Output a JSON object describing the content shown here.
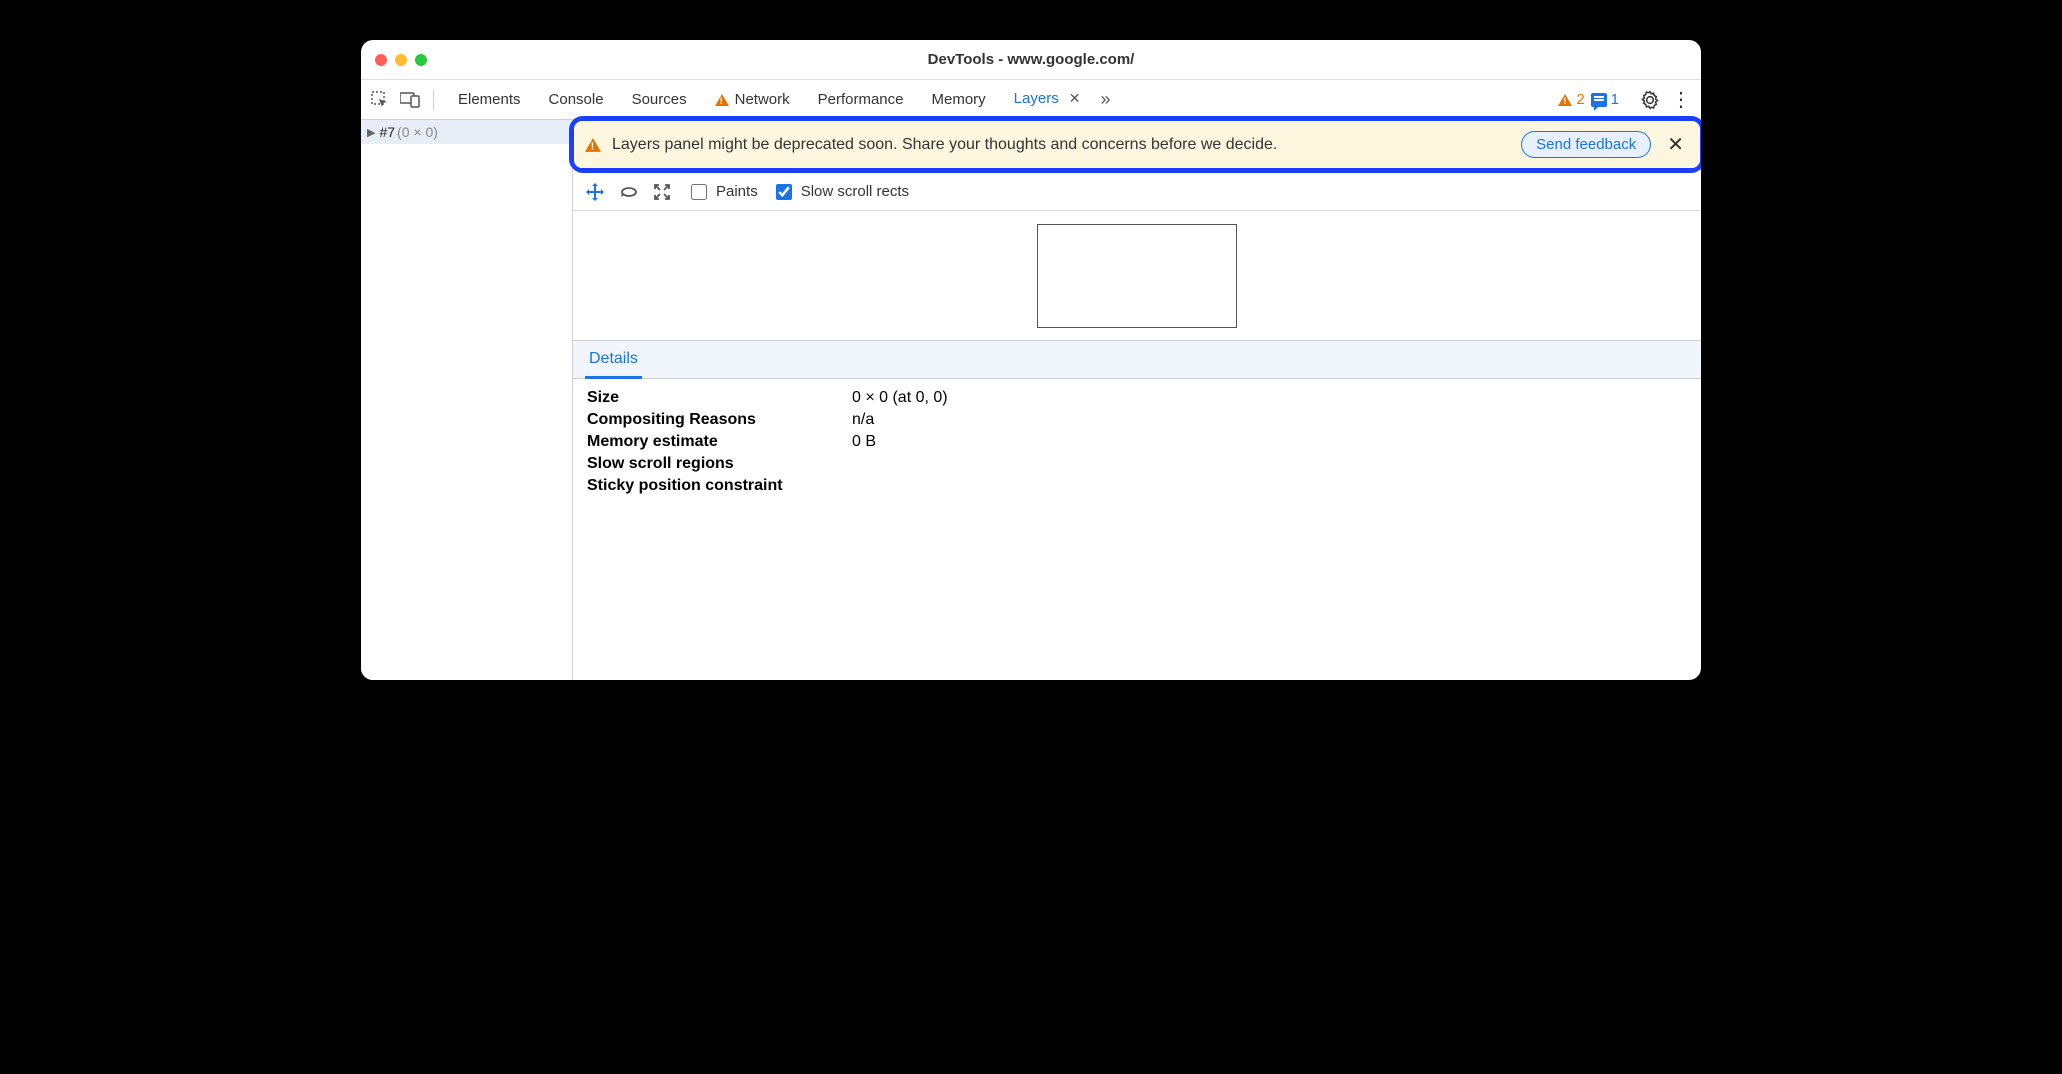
{
  "window": {
    "title": "DevTools - www.google.com/"
  },
  "toolbar": {
    "tabs": [
      "Elements",
      "Console",
      "Sources",
      "Network",
      "Performance",
      "Memory",
      "Layers"
    ],
    "active_tab": "Layers",
    "network_has_warning": true,
    "warn_count": "2",
    "info_count": "1"
  },
  "sidebar": {
    "item_id": "#7",
    "item_dim": "(0 × 0)"
  },
  "banner": {
    "message": "Layers panel might be deprecated soon. Share your thoughts and concerns before we decide.",
    "button": "Send feedback"
  },
  "layer_toolbar": {
    "paints_label": "Paints",
    "paints_checked": false,
    "slow_label": "Slow scroll rects",
    "slow_checked": true
  },
  "details": {
    "tab": "Details",
    "rows": [
      {
        "label": "Size",
        "value": "0 × 0 (at 0, 0)"
      },
      {
        "label": "Compositing Reasons",
        "value": "n/a"
      },
      {
        "label": "Memory estimate",
        "value": "0 B"
      },
      {
        "label": "Slow scroll regions",
        "value": ""
      },
      {
        "label": "Sticky position constraint",
        "value": ""
      }
    ]
  }
}
